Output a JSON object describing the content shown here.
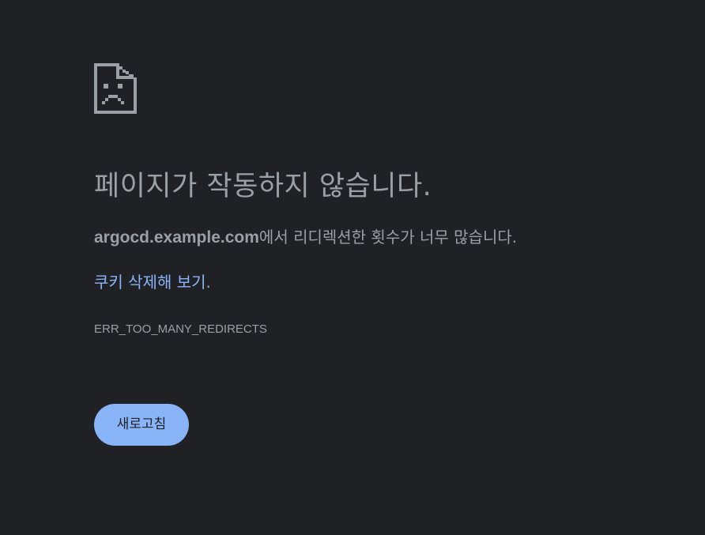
{
  "icon": "sad-document-icon",
  "colors": {
    "background": "#202124",
    "text": "#9aa0a6",
    "link": "#8ab4f8",
    "button_background": "#8ab4f8",
    "button_text": "#202124"
  },
  "main": {
    "heading": "페이지가 작동하지 않습니다.",
    "detail_host": "argocd.example.com",
    "detail_text": "에서 리디렉션한 횟수가 너무 많습니다.",
    "suggestion_link": "쿠키 삭제해 보기",
    "suggestion_suffix": ".",
    "error_code": "ERR_TOO_MANY_REDIRECTS",
    "reload_label": "새로고침"
  }
}
